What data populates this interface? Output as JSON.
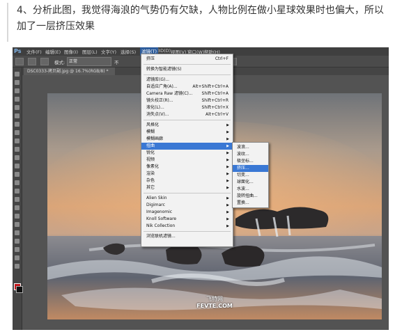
{
  "caption": {
    "line1": "4、分析此图，我觉得海浪的气势仍有欠缺，人物比例在做小星球效果时也偏大，所以",
    "line2": "加了一层挤压效果"
  },
  "app": {
    "logo": "Ps",
    "menubar": [
      "文件(F)",
      "编辑(E)",
      "图像(I)",
      "图层(L)",
      "文字(Y)",
      "选择(S)",
      "滤镜(T)",
      "3D(D)",
      "视图(V)",
      "窗口(W)",
      "帮助(H)"
    ],
    "active_menu_index": 6,
    "options": {
      "mode_label": "模式:",
      "mode_value": "正常",
      "opacity_label": "不"
    },
    "document_tab": "DSC0333-拷贝副.jpg @ 16.7%(RGB/8) *"
  },
  "filter_menu": {
    "items": [
      {
        "label": "挤压",
        "shortcut": "Ctrl+F"
      },
      {
        "type": "sep"
      },
      {
        "label": "转换为智能滤镜(S)"
      },
      {
        "type": "sep"
      },
      {
        "label": "滤镜库(G)..."
      },
      {
        "label": "自适应广角(A)...",
        "shortcut": "Alt+Shift+Ctrl+A"
      },
      {
        "label": "Camera Raw 滤镜(C)...",
        "shortcut": "Shift+Ctrl+A"
      },
      {
        "label": "镜头校正(R)...",
        "shortcut": "Shift+Ctrl+R"
      },
      {
        "label": "液化(L)...",
        "shortcut": "Shift+Ctrl+X"
      },
      {
        "label": "消失点(V)...",
        "shortcut": "Alt+Ctrl+V"
      },
      {
        "type": "sep"
      },
      {
        "label": "风格化",
        "sub": true
      },
      {
        "label": "模糊",
        "sub": true
      },
      {
        "label": "模糊画廊",
        "sub": true
      },
      {
        "label": "扭曲",
        "sub": true,
        "highlighted": true
      },
      {
        "label": "锐化",
        "sub": true
      },
      {
        "label": "视频",
        "sub": true
      },
      {
        "label": "像素化",
        "sub": true
      },
      {
        "label": "渲染",
        "sub": true
      },
      {
        "label": "杂色",
        "sub": true
      },
      {
        "label": "其它",
        "sub": true
      },
      {
        "type": "sep"
      },
      {
        "label": "Alien Skin",
        "sub": true
      },
      {
        "label": "Digimarc",
        "sub": true
      },
      {
        "label": "Imagenomic",
        "sub": true
      },
      {
        "label": "Knoll Software",
        "sub": true
      },
      {
        "label": "Nik Collection",
        "sub": true
      },
      {
        "type": "sep"
      },
      {
        "label": "浏览联机滤镜..."
      }
    ]
  },
  "distort_submenu": {
    "items": [
      {
        "label": "波浪..."
      },
      {
        "label": "波纹..."
      },
      {
        "label": "极坐标..."
      },
      {
        "label": "挤压...",
        "highlighted": true
      },
      {
        "label": "切变..."
      },
      {
        "label": "球面化..."
      },
      {
        "label": "水波..."
      },
      {
        "label": "旋转扭曲..."
      },
      {
        "label": "置换..."
      }
    ]
  },
  "watermark": {
    "line1": "飞特网",
    "line2": "FEVTE.COM"
  }
}
